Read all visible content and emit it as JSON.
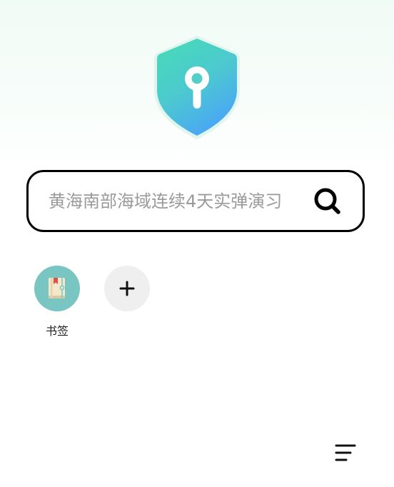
{
  "logo": {
    "icon": "shield-keyhole-icon",
    "colors": {
      "top": "#47dcb6",
      "bottom": "#4aa8f3"
    }
  },
  "search": {
    "placeholder": "黄海南部海域连续4天实弹演习",
    "icon": "search-icon"
  },
  "shortcuts": [
    {
      "label": "书签",
      "icon": "book-icon",
      "color": "#79c5c1"
    },
    {
      "label": "",
      "icon": "plus-icon",
      "color": "#efefef"
    }
  ],
  "menu": {
    "icon": "menu-icon"
  }
}
